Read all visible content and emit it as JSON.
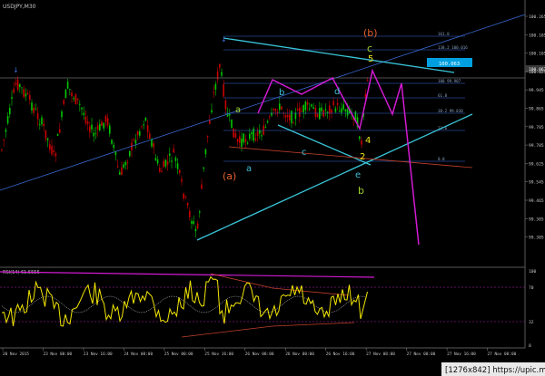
{
  "window": {
    "symbol_label": "USDJPY,M30"
  },
  "watermark": "[1276x842] https://upic.me/",
  "colors": {
    "background": "#000000",
    "candle_up": "#00c800",
    "candle_down": "#c80000",
    "trendline_cyan": "#39c6d9",
    "channel_blue": "#3a6bd6",
    "projection_magenta": "#d21ad2",
    "rsi_line": "#f2e600",
    "rsi_dotted": "#bfbfbf",
    "rsi_level": "#c01ec0",
    "rsi_trend": "#c0402a",
    "label_orange": "#e2612c",
    "label_yellow": "#e8e21b",
    "label_cyan": "#3fbfd6",
    "label_green": "#9fd12a",
    "fib_label": "#8aa0c0",
    "price_box": "#00a0e0"
  },
  "price_axis": {
    "ticks": [
      "100.265",
      "100.185",
      "100.105",
      "100.025",
      "99.945",
      "99.865",
      "99.785",
      "99.705",
      "99.625",
      "99.545",
      "99.465",
      "99.385",
      "99.305"
    ],
    "current_price": "100.063"
  },
  "rsi_axis": {
    "ticks": [
      "100",
      "70",
      "32",
      "0"
    ],
    "title": "RSI(14) 61.5556"
  },
  "time_axis": {
    "ticks": [
      "20 Nov 2015",
      "23 Nov 00:00",
      "23 Nov 16:00",
      "24 Nov 08:00",
      "25 Nov 00:00",
      "25 Nov 16:00",
      "26 Nov 08:00",
      "26 Nov 00:00",
      "26 Nov 16:00",
      "27 Nov 08:00",
      "27 Nov 00:00",
      "27 Nov 16:00",
      "27 Nov 08:00"
    ]
  },
  "fib_levels": [
    "161.8",
    "138.2  100.016",
    "100  99.907",
    "61.8",
    "38.2  99.830",
    "23.6",
    "0.0"
  ],
  "wave_labels": {
    "b_paren": "(b)",
    "a_paren": "(a)",
    "a_upper": "a",
    "b_upper": "b",
    "c_mid": "c",
    "d_upper": "d",
    "e_lower": "e",
    "a_lower": "a",
    "b_lower": "b",
    "c_top": "c",
    "n5": "5",
    "n4": "4",
    "n2": "2"
  },
  "markers": {
    "up_arrow": "↓"
  }
}
